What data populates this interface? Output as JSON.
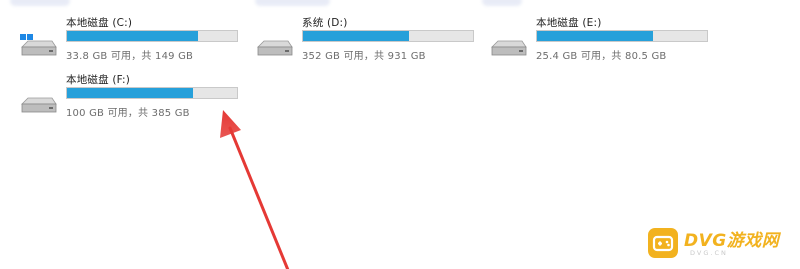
{
  "drives": [
    {
      "name": "本地磁盘 (C:)",
      "free_text": "33.8 GB 可用，共 149 GB",
      "used_fraction": 0.773,
      "icon": "windows-drive-icon",
      "bar_color": "#26a0da"
    },
    {
      "name": "系统 (D:)",
      "free_text": "352 GB 可用，共 931 GB",
      "used_fraction": 0.622,
      "icon": "hard-drive-icon",
      "bar_color": "#26a0da"
    },
    {
      "name": "本地磁盘 (E:)",
      "free_text": "25.4 GB 可用，共 80.5 GB",
      "used_fraction": 0.684,
      "icon": "hard-drive-icon",
      "bar_color": "#26a0da"
    },
    {
      "name": "本地磁盘 (F:)",
      "free_text": "100 GB 可用，共 385 GB",
      "used_fraction": 0.74,
      "icon": "hard-drive-icon",
      "bar_color": "#26a0da"
    }
  ],
  "annotation": {
    "arrow_color": "#e53935"
  },
  "watermark": {
    "brand": "DVG游戏网",
    "url": "DVG.CN",
    "badge_icon": "gamepad-icon",
    "color": "#f2b21f"
  }
}
